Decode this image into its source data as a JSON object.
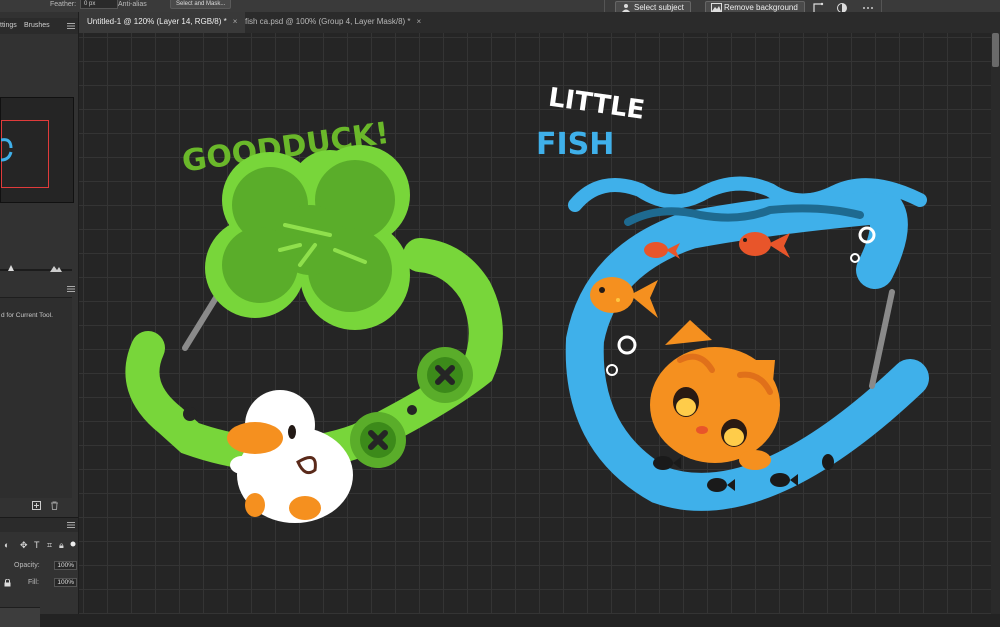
{
  "options_bar": {
    "feather_label": "Feather:",
    "feather_value": "0 px",
    "antialias_label": "Anti-alias",
    "select_mask_label": "Select and Mask..."
  },
  "context_bar": {
    "select_subject_label": "Select subject",
    "remove_background_label": "Remove background"
  },
  "left_panel": {
    "tab_partial": "ttings",
    "tab_brushes": "Brushes",
    "properties_text": "d for Current Tool.",
    "opacity_label": "Opacity:",
    "opacity_value": "100%",
    "fill_label": "Fill:",
    "fill_value": "100%"
  },
  "document_tabs": [
    {
      "title": "Untitled-1 @ 120% (Layer 14, RGB/8) *",
      "close": "×"
    },
    {
      "title": "fish ca.psd @ 100% (Group 4, Layer Mask/8) *",
      "close": "×"
    }
  ],
  "artwork": {
    "duck_title": "GOODDUCK!",
    "fish_title_top": "LITTLE",
    "fish_title_bottom": "FISH"
  },
  "colors": {
    "ui_bg": "#323232",
    "canvas_bg": "#252525",
    "clover_green": "#5aad2a",
    "ring_green": "#78d63a",
    "ring_blue": "#3fb0ea",
    "cat_orange": "#f5901f",
    "title_green": "#6ab82a",
    "title_blue": "#3fb0ea"
  }
}
